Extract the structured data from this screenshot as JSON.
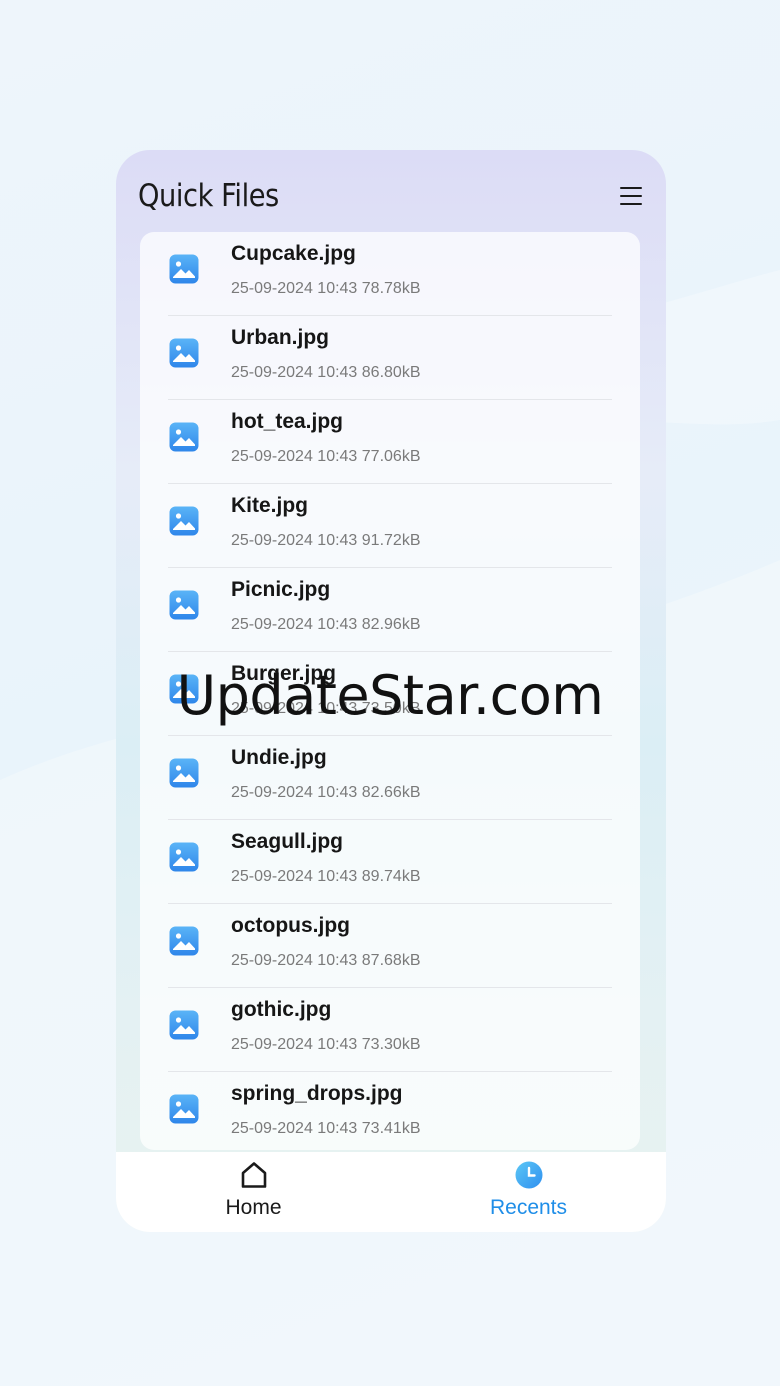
{
  "header": {
    "title": "Quick Files",
    "menu_icon": "menu-icon"
  },
  "files": [
    {
      "name": "Cupcake.jpg",
      "meta": "25-09-2024 10:43 78.78kB",
      "icon": "image-icon"
    },
    {
      "name": "Urban.jpg",
      "meta": "25-09-2024 10:43 86.80kB",
      "icon": "image-icon"
    },
    {
      "name": "hot_tea.jpg",
      "meta": "25-09-2024 10:43 77.06kB",
      "icon": "image-icon"
    },
    {
      "name": "Kite.jpg",
      "meta": "25-09-2024 10:43 91.72kB",
      "icon": "image-icon"
    },
    {
      "name": "Picnic.jpg",
      "meta": "25-09-2024 10:43 82.96kB",
      "icon": "image-icon"
    },
    {
      "name": "Burger.jpg",
      "meta": "25-09-2024 10:43 73.50kB",
      "icon": "image-icon"
    },
    {
      "name": "Undie.jpg",
      "meta": "25-09-2024 10:43 82.66kB",
      "icon": "image-icon"
    },
    {
      "name": "Seagull.jpg",
      "meta": "25-09-2024 10:43 89.74kB",
      "icon": "image-icon"
    },
    {
      "name": "octopus.jpg",
      "meta": "25-09-2024 10:43 87.68kB",
      "icon": "image-icon"
    },
    {
      "name": "gothic.jpg",
      "meta": "25-09-2024 10:43 73.30kB",
      "icon": "image-icon"
    },
    {
      "name": "spring_drops.jpg",
      "meta": "25-09-2024 10:43 73.41kB",
      "icon": "image-icon"
    }
  ],
  "nav": {
    "home": {
      "label": "Home",
      "icon": "home-icon",
      "active": false
    },
    "recents": {
      "label": "Recents",
      "icon": "clock-icon",
      "active": true
    }
  },
  "colors": {
    "accent": "#1f8ee8",
    "icon_blue": "#3d9bf0",
    "text": "#161616",
    "meta": "#7a7a7a"
  },
  "watermark": "UpdateStar.com"
}
